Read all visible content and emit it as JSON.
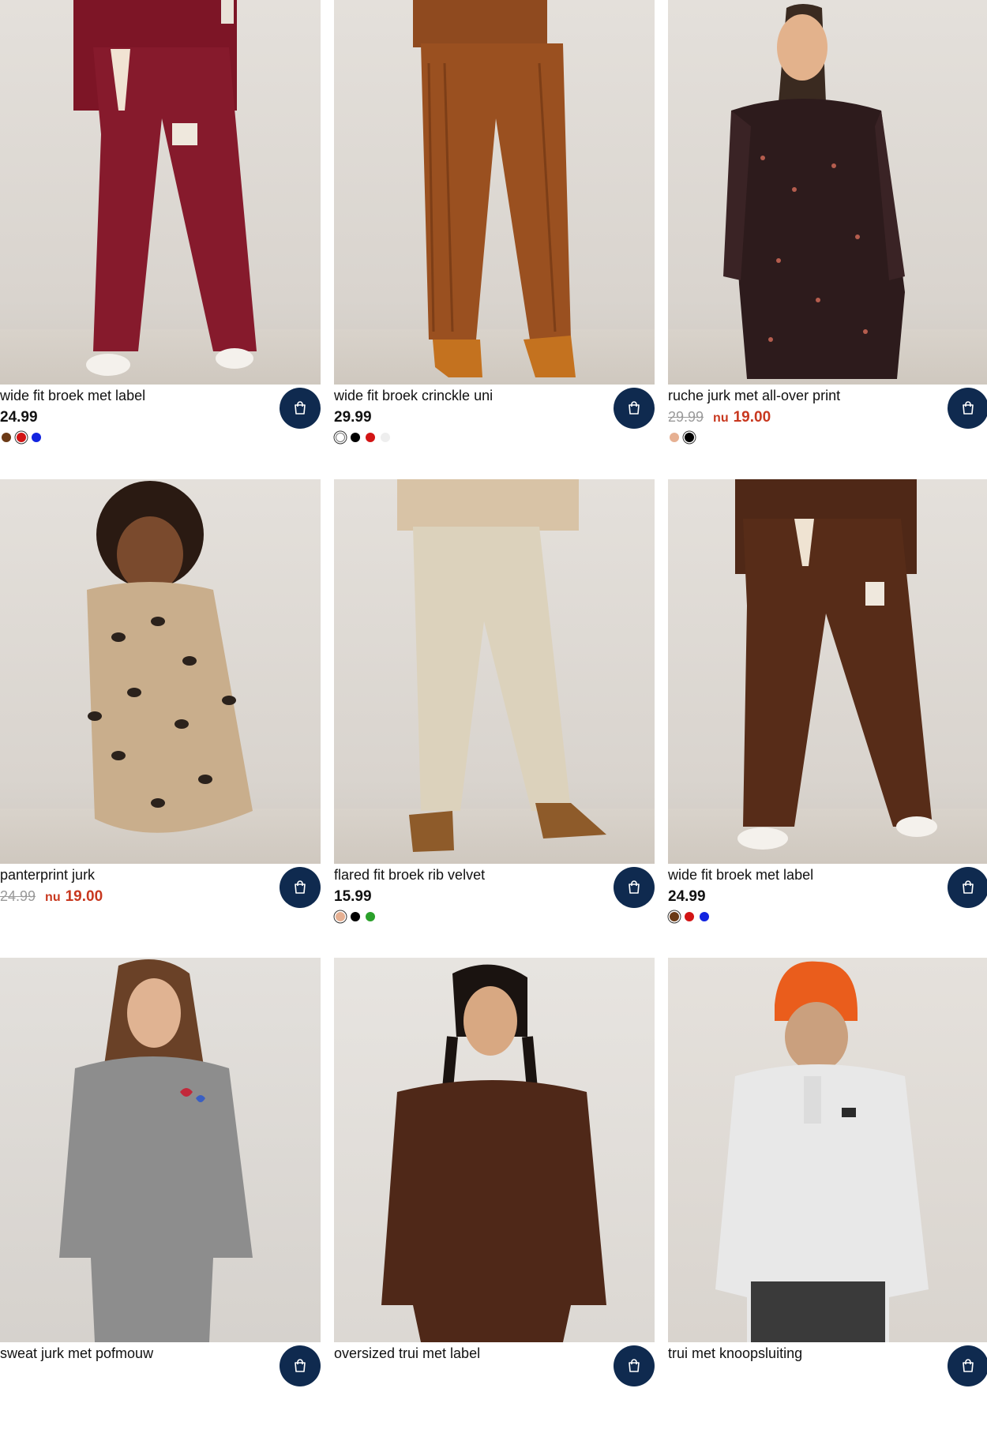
{
  "products": [
    {
      "title": "wide fit broek met label",
      "price": "24.99",
      "old_price": "",
      "sale_prefix": "",
      "sale_price": "",
      "image": "red wide fit trousers",
      "swatches": [
        "#6b3a16",
        "#d21414",
        "#1224e0"
      ],
      "selected_swatch": 1
    },
    {
      "title": "wide fit broek crinckle uni",
      "price": "29.99",
      "old_price": "",
      "sale_prefix": "",
      "sale_price": "",
      "image": "rust crinkle trousers",
      "swatches": [
        "#ffffff",
        "#000000",
        "#d21414",
        "#eeeeee"
      ],
      "selected_swatch": 0
    },
    {
      "title": "ruche jurk met all-over print",
      "price": "",
      "old_price": "29.99",
      "sale_prefix": "nu",
      "sale_price": "19.00",
      "image": "girl in floral dress",
      "swatches": [
        "#e6b092",
        "#000000"
      ],
      "selected_swatch": 1
    },
    {
      "title": "panterprint jurk",
      "price": "",
      "old_price": "24.99",
      "sale_prefix": "nu",
      "sale_price": "19.00",
      "image": "girl in leopard print dress",
      "swatches": [],
      "selected_swatch": -1
    },
    {
      "title": "flared fit broek rib velvet",
      "price": "15.99",
      "old_price": "",
      "sale_prefix": "",
      "sale_price": "",
      "image": "beige flared velvet trousers",
      "swatches": [
        "#e6b092",
        "#000000",
        "#2aa02a"
      ],
      "selected_swatch": 0
    },
    {
      "title": "wide fit broek met label",
      "price": "24.99",
      "old_price": "",
      "sale_prefix": "",
      "sale_price": "",
      "image": "brown wide fit trousers",
      "swatches": [
        "#6b3a16",
        "#d21414",
        "#1224e0"
      ],
      "selected_swatch": 0
    },
    {
      "title": "sweat jurk met pofmouw",
      "price": "",
      "old_price": "",
      "sale_prefix": "",
      "sale_price": "",
      "image": "girl in grey sweat dress",
      "swatches": [],
      "selected_swatch": -1
    },
    {
      "title": "oversized trui met label",
      "price": "",
      "old_price": "",
      "sale_prefix": "",
      "sale_price": "",
      "image": "girl in brown oversized sweater",
      "swatches": [],
      "selected_swatch": -1
    },
    {
      "title": "trui met knoopsluiting",
      "price": "",
      "old_price": "",
      "sale_prefix": "",
      "sale_price": "",
      "image": "boy in grey sweater with orange beanie",
      "swatches": [],
      "selected_swatch": -1
    }
  ],
  "icons": {
    "cart": "shopping-bag-icon"
  },
  "colors": {
    "cart_button": "#0f2a4f",
    "sale": "#c8381f",
    "old_price": "#9a9a9a"
  }
}
